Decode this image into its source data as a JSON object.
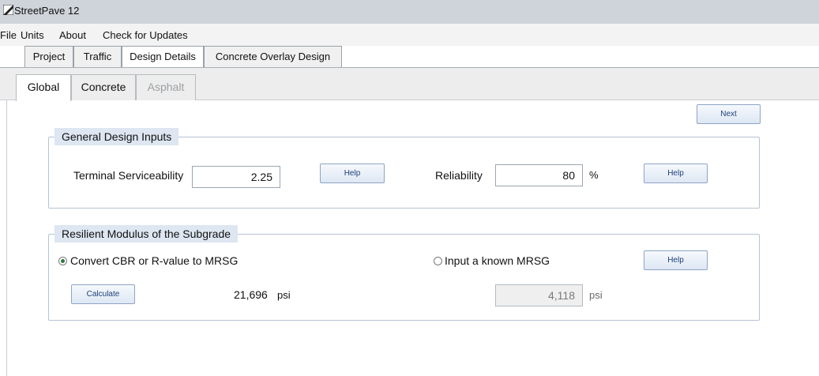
{
  "app": {
    "title": "StreetPave 12"
  },
  "menu": [
    "File",
    "Units",
    "About",
    "Check for Updates"
  ],
  "outer_tabs": [
    "Project",
    "Traffic",
    "Design Details",
    "Concrete Overlay Design"
  ],
  "outer_tab_active": "Design Details",
  "inner_tabs": [
    "Global",
    "Concrete",
    "Asphalt"
  ],
  "inner_tab_active": "Global",
  "next_button": "Next",
  "general": {
    "title": "General Design Inputs",
    "terminal_label": "Terminal Serviceability",
    "terminal_value": "2.25",
    "help1": "Help",
    "reliability_label": "Reliability",
    "reliability_value": "80",
    "reliability_unit": "%",
    "help2": "Help"
  },
  "resilient": {
    "title": "Resilient Modulus of the Subgrade",
    "option_convert": "Convert CBR or R-value to MRSG",
    "option_known": "Input a known MRSG",
    "selected_option": "option_convert",
    "help": "Help",
    "calculate": "Calculate",
    "calc_value": "21,696",
    "calc_unit": "psi",
    "known_value": "4,118",
    "known_unit": "psi"
  }
}
